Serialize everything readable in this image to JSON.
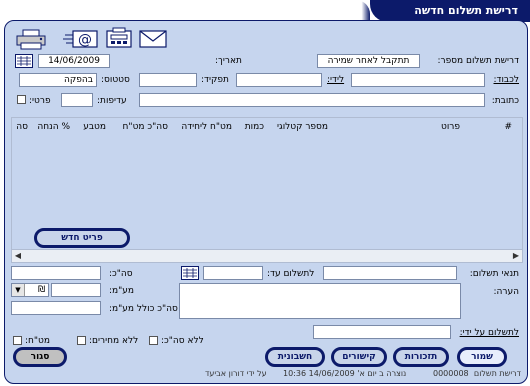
{
  "window": {
    "title": "דרישת תשלום חדשה"
  },
  "header": {
    "request_number_label": "דרישת תשלום מספר:",
    "request_number_value": "תתקבל לאחר שמירה",
    "date_label": "תאריך:",
    "date_value": "14/06/2009",
    "to_label": "לכבוד:",
    "to_value": "",
    "attn_label": "לידי:",
    "attn_value": "",
    "role_label": "תפקיד:",
    "role_value": "",
    "status_label": "סטטוס:",
    "status_value": "בהפקה",
    "address_label": "כתובת:",
    "address_value": "",
    "priority_label": "עדיפות:",
    "priority_value": "",
    "private_label": "פרטי:"
  },
  "toolbar_icons": [
    "envelope-icon",
    "fax-icon",
    "email-icon",
    "printer-icon"
  ],
  "grid": {
    "columns": [
      "#",
      "פרוט",
      "מספר קטלוגי",
      "כמות",
      "מט\"ח ליחידה",
      "סה\"כ מט\"ח",
      "מטבע",
      "% הנחה",
      "סה"
    ],
    "rows": []
  },
  "new_item_button": "פריט חדש",
  "footer": {
    "payment_terms_label": "תנאי תשלום:",
    "payment_terms_value": "",
    "pay_until_label": "לתשלום עד:",
    "pay_until_value": "",
    "total_label": "סה\"כ:",
    "total_value": "",
    "note_label": "הערה:",
    "vat_label": "מע\"מ:",
    "vat_value": "",
    "currency_value": "₪",
    "total_incl_vat_label": "סה\"כ כולל מע\"מ:",
    "total_incl_vat_value": "",
    "pay_by_label": "לתשלום על ידי:",
    "pay_by_value": "",
    "no_total_label": "ללא סה\"כ:",
    "no_prices_label": "ללא מחירים:",
    "vat_check_label": "מט\"ח:"
  },
  "buttons": {
    "save": "שמור",
    "reminders": "תזכורות",
    "links": "קישורים",
    "accounting": "חשבונית",
    "close": "סגור"
  },
  "status_bar": {
    "doc_type": "דרישת תשלום",
    "doc_number": "0000008",
    "created_text": "נוצרה ב יום א' 14/06/2009 10:36",
    "by_text": "על ידי דורון אביעד"
  }
}
